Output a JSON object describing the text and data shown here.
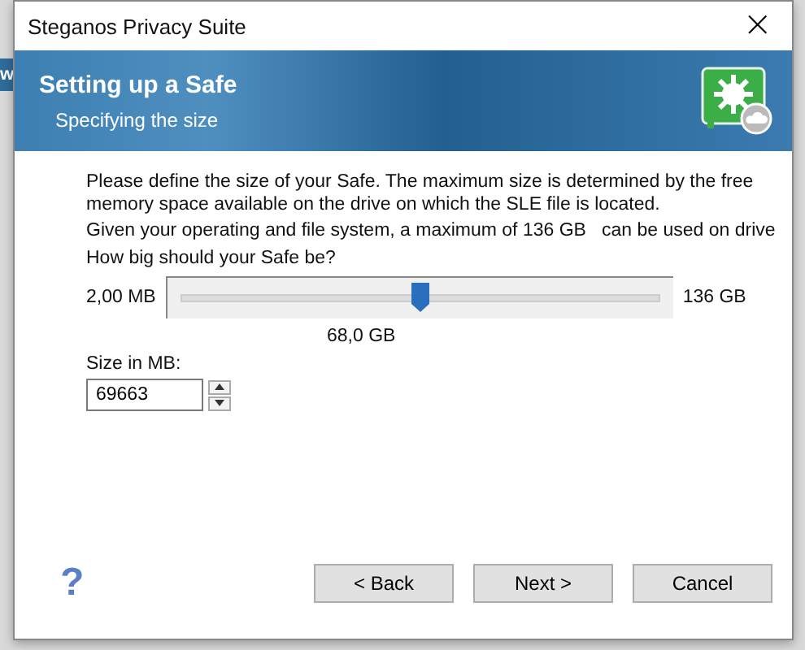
{
  "background_window": {
    "text": "w"
  },
  "window": {
    "title": "Steganos Privacy Suite",
    "close": "×"
  },
  "banner": {
    "title": "Setting up a Safe",
    "subtitle": "Specifying the size"
  },
  "description": [
    "Please define the size of your Safe. The maximum size is determined by the free memory space available on the drive on which the SLE file is located.",
    "Given your operating and file system, a maximum of 136 GB   can be used on drive"
  ],
  "question": "How big should your Safe be?",
  "slider": {
    "min_label": "2,00 MB",
    "max_label": "136 GB",
    "level": 0.5,
    "reading": "68,0 GB"
  },
  "size_field": {
    "label": "Size in MB:",
    "value": "69663"
  },
  "help": "?",
  "buttons": [
    "< Back",
    "Next >",
    "Cancel"
  ]
}
